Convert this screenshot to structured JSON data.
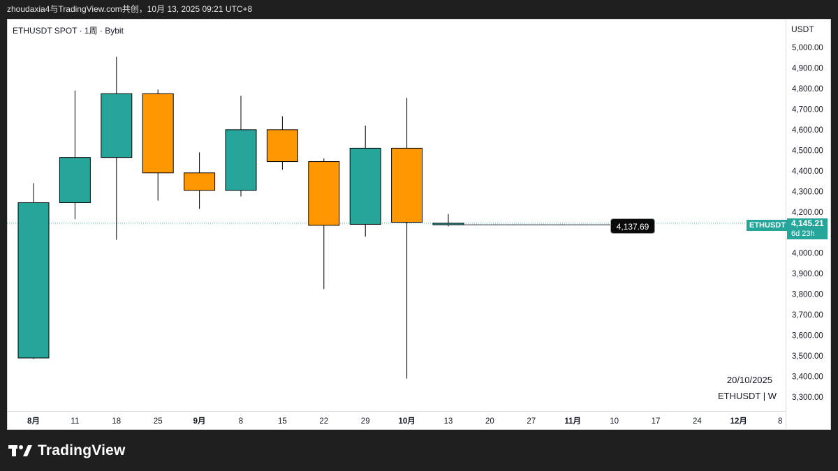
{
  "header": {
    "share_text": "zhoudaxia4与TradingView.com共创，10月 13, 2025 09:21 UTC+8"
  },
  "chart_header": {
    "symbol_label": "ETHUSDT SPOT · 1周 · Bybit",
    "currency": "USDT"
  },
  "overlay": {
    "date": "20/10/2025",
    "symbol_interval": "ETHUSDT | W"
  },
  "price_tag": "4,137.69",
  "last_price": {
    "symbol": "ETHUSDT",
    "price": "4,145.21",
    "countdown": "6d 23h"
  },
  "footer": {
    "brand": "TradingView"
  },
  "colors": {
    "up": "#26a69a",
    "down": "#ff9800",
    "axis_text": "#131722",
    "background": "#ffffff"
  },
  "chart_data": {
    "type": "candlestick",
    "yaxis": {
      "min": 3250,
      "max": 5100,
      "ticks": [
        3300,
        3400,
        3500,
        3600,
        3700,
        3800,
        3900,
        4000,
        4100,
        4200,
        4300,
        4400,
        4500,
        4600,
        4700,
        4800,
        4900,
        5000
      ],
      "tick_labels": [
        "3,300.00",
        "3,400.00",
        "3,500.00",
        "3,600.00",
        "3,700.00",
        "3,800.00",
        "3,900.00",
        "4,000.00",
        "4,100.00",
        "4,200.00",
        "4,300.00",
        "4,400.00",
        "4,500.00",
        "4,600.00",
        "4,700.00",
        "4,800.00",
        "4,900.00",
        "5,000.00"
      ]
    },
    "xaxis": {
      "labels": [
        "8月",
        "11",
        "18",
        "25",
        "9月",
        "8",
        "15",
        "22",
        "29",
        "10月",
        "13",
        "20",
        "27",
        "11月",
        "10",
        "17",
        "24",
        "12月",
        "8"
      ],
      "bold": [
        true,
        false,
        false,
        false,
        true,
        false,
        false,
        false,
        false,
        true,
        false,
        false,
        false,
        true,
        false,
        false,
        false,
        true,
        false
      ]
    },
    "candles": [
      {
        "open": 3490,
        "high": 4340,
        "low": 3485,
        "close": 4245
      },
      {
        "open": 4245,
        "high": 4790,
        "low": 4165,
        "close": 4465
      },
      {
        "open": 4465,
        "high": 4955,
        "low": 4065,
        "close": 4775
      },
      {
        "open": 4775,
        "high": 4795,
        "low": 4255,
        "close": 4390
      },
      {
        "open": 4390,
        "high": 4490,
        "low": 4215,
        "close": 4305
      },
      {
        "open": 4305,
        "high": 4765,
        "low": 4275,
        "close": 4600
      },
      {
        "open": 4600,
        "high": 4665,
        "low": 4405,
        "close": 4445
      },
      {
        "open": 4445,
        "high": 4460,
        "low": 3825,
        "close": 4135
      },
      {
        "open": 4140,
        "high": 4620,
        "low": 4080,
        "close": 4510
      },
      {
        "open": 4510,
        "high": 4755,
        "low": 3390,
        "close": 4150
      },
      {
        "open": 4137.69,
        "high": 4190,
        "low": 4130,
        "close": 4145.21
      }
    ],
    "last_price": 4145.21,
    "price_line": 4137.69
  }
}
